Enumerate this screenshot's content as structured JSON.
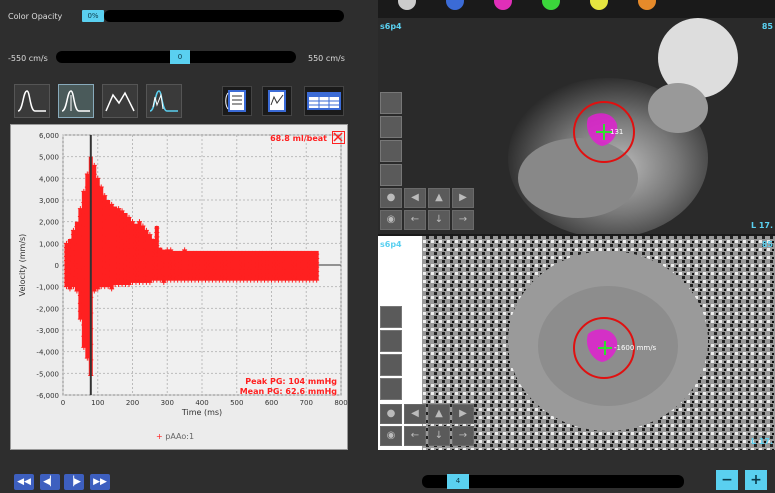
{
  "controls": {
    "color_opacity_label": "Color Opacity",
    "color_opacity_value": "0%",
    "velocity_min": "-550 cm/s",
    "velocity_max": "550 cm/s",
    "velocity_value": "0"
  },
  "chart": {
    "flow_readout": "68.8 ml/beat",
    "peak_pg": "Peak PG: 104 mmHg",
    "mean_pg": "Mean PG: 62.6 mmHg",
    "legend_label": "pAAo:1"
  },
  "chart_data": {
    "type": "scatter",
    "xlabel": "Time (ms)",
    "ylabel": "Velocity (mm/s)",
    "xlim": [
      0,
      800
    ],
    "ylim": [
      -6000,
      6000
    ],
    "x_ticks": [
      "0",
      "100",
      "200",
      "300",
      "400",
      "500",
      "600",
      "700",
      "800"
    ],
    "y_ticks": [
      "6,000",
      "5,000",
      "4,000",
      "3,000",
      "2,000",
      "1,000",
      "0",
      "-1,000",
      "-2,000",
      "-3,000",
      "-4,000",
      "-5,000",
      "-6,000"
    ],
    "cursor_x": 80,
    "series": [
      {
        "name": "pAAo:1",
        "color": "#ff2020",
        "columns": [
          {
            "x": 10,
            "max": 1000,
            "min": -1000
          },
          {
            "x": 20,
            "max": 1200,
            "min": -1100
          },
          {
            "x": 30,
            "max": 1600,
            "min": -1000
          },
          {
            "x": 40,
            "max": 2000,
            "min": -1200
          },
          {
            "x": 50,
            "max": 2600,
            "min": -2500
          },
          {
            "x": 60,
            "max": 3400,
            "min": -3800
          },
          {
            "x": 70,
            "max": 4200,
            "min": -4300
          },
          {
            "x": 80,
            "max": 5000,
            "min": -5100
          },
          {
            "x": 90,
            "max": 4600,
            "min": -1200
          },
          {
            "x": 100,
            "max": 4000,
            "min": -1100
          },
          {
            "x": 110,
            "max": 3600,
            "min": -1000
          },
          {
            "x": 120,
            "max": 3200,
            "min": -1000
          },
          {
            "x": 130,
            "max": 3000,
            "min": -1000
          },
          {
            "x": 140,
            "max": 2800,
            "min": -1100
          },
          {
            "x": 150,
            "max": 2700,
            "min": -900
          },
          {
            "x": 160,
            "max": 2600,
            "min": -900
          },
          {
            "x": 170,
            "max": 2500,
            "min": -900
          },
          {
            "x": 180,
            "max": 2400,
            "min": -900
          },
          {
            "x": 190,
            "max": 2200,
            "min": -900
          },
          {
            "x": 200,
            "max": 2000,
            "min": -800
          },
          {
            "x": 210,
            "max": 1900,
            "min": -800
          },
          {
            "x": 220,
            "max": 2000,
            "min": -800
          },
          {
            "x": 230,
            "max": 1800,
            "min": -800
          },
          {
            "x": 240,
            "max": 1600,
            "min": -800
          },
          {
            "x": 250,
            "max": 1400,
            "min": -800
          },
          {
            "x": 260,
            "max": 1200,
            "min": -700
          },
          {
            "x": 270,
            "max": 1800,
            "min": -700
          },
          {
            "x": 280,
            "max": 800,
            "min": -700
          },
          {
            "x": 290,
            "max": 700,
            "min": -800
          },
          {
            "x": 300,
            "max": 700,
            "min": -700
          },
          {
            "x": 310,
            "max": 700,
            "min": -700
          },
          {
            "x": 320,
            "max": 650,
            "min": -700
          },
          {
            "x": 330,
            "max": 650,
            "min": -700
          },
          {
            "x": 340,
            "max": 650,
            "min": -700
          },
          {
            "x": 350,
            "max": 700,
            "min": -700
          },
          {
            "x": 360,
            "max": 650,
            "min": -700
          },
          {
            "x": 370,
            "max": 650,
            "min": -700
          },
          {
            "x": 380,
            "max": 650,
            "min": -700
          },
          {
            "x": 390,
            "max": 650,
            "min": -700
          },
          {
            "x": 400,
            "max": 650,
            "min": -700
          },
          {
            "x": 410,
            "max": 650,
            "min": -700
          },
          {
            "x": 420,
            "max": 650,
            "min": -700
          },
          {
            "x": 430,
            "max": 650,
            "min": -700
          },
          {
            "x": 440,
            "max": 650,
            "min": -700
          },
          {
            "x": 450,
            "max": 650,
            "min": -700
          },
          {
            "x": 460,
            "max": 650,
            "min": -700
          },
          {
            "x": 470,
            "max": 650,
            "min": -700
          },
          {
            "x": 480,
            "max": 650,
            "min": -700
          },
          {
            "x": 490,
            "max": 650,
            "min": -700
          },
          {
            "x": 500,
            "max": 650,
            "min": -700
          },
          {
            "x": 510,
            "max": 650,
            "min": -700
          },
          {
            "x": 520,
            "max": 650,
            "min": -700
          },
          {
            "x": 530,
            "max": 650,
            "min": -700
          },
          {
            "x": 540,
            "max": 650,
            "min": -700
          },
          {
            "x": 550,
            "max": 650,
            "min": -700
          },
          {
            "x": 560,
            "max": 650,
            "min": -700
          },
          {
            "x": 570,
            "max": 650,
            "min": -700
          },
          {
            "x": 580,
            "max": 650,
            "min": -700
          },
          {
            "x": 590,
            "max": 650,
            "min": -700
          },
          {
            "x": 600,
            "max": 650,
            "min": -700
          },
          {
            "x": 610,
            "max": 650,
            "min": -700
          },
          {
            "x": 620,
            "max": 650,
            "min": -700
          },
          {
            "x": 630,
            "max": 650,
            "min": -700
          },
          {
            "x": 640,
            "max": 650,
            "min": -700
          },
          {
            "x": 650,
            "max": 650,
            "min": -700
          },
          {
            "x": 660,
            "max": 650,
            "min": -700
          },
          {
            "x": 670,
            "max": 650,
            "min": -700
          },
          {
            "x": 680,
            "max": 650,
            "min": -700
          },
          {
            "x": 690,
            "max": 650,
            "min": -700
          },
          {
            "x": 700,
            "max": 650,
            "min": -700
          },
          {
            "x": 710,
            "max": 650,
            "min": -700
          },
          {
            "x": 720,
            "max": 650,
            "min": -700
          },
          {
            "x": 730,
            "max": 650,
            "min": -700
          }
        ]
      }
    ],
    "grid": true,
    "legend": "bottom-center"
  },
  "viewer": {
    "top_label": "s6p4",
    "top_right_label": "85",
    "top_corner_br": "L 17.",
    "roi_top_value": "131",
    "bot_label": "s6p4",
    "bot_right_label": "85",
    "bot_corner_br": "L 17.",
    "roi_bot_value": "-1600 mm/s",
    "palette": [
      "#cccccc",
      "#3b6bd6",
      "#e02fb8",
      "#3bd63b",
      "#e6e640",
      "#e68a2a"
    ]
  },
  "playback": {
    "frame_value": "4",
    "zoom_out": "−",
    "zoom_in": "+",
    "btn_first": "◀◀",
    "btn_prev": "◀▏",
    "btn_next": "▕▶",
    "btn_last": "▶▶"
  }
}
